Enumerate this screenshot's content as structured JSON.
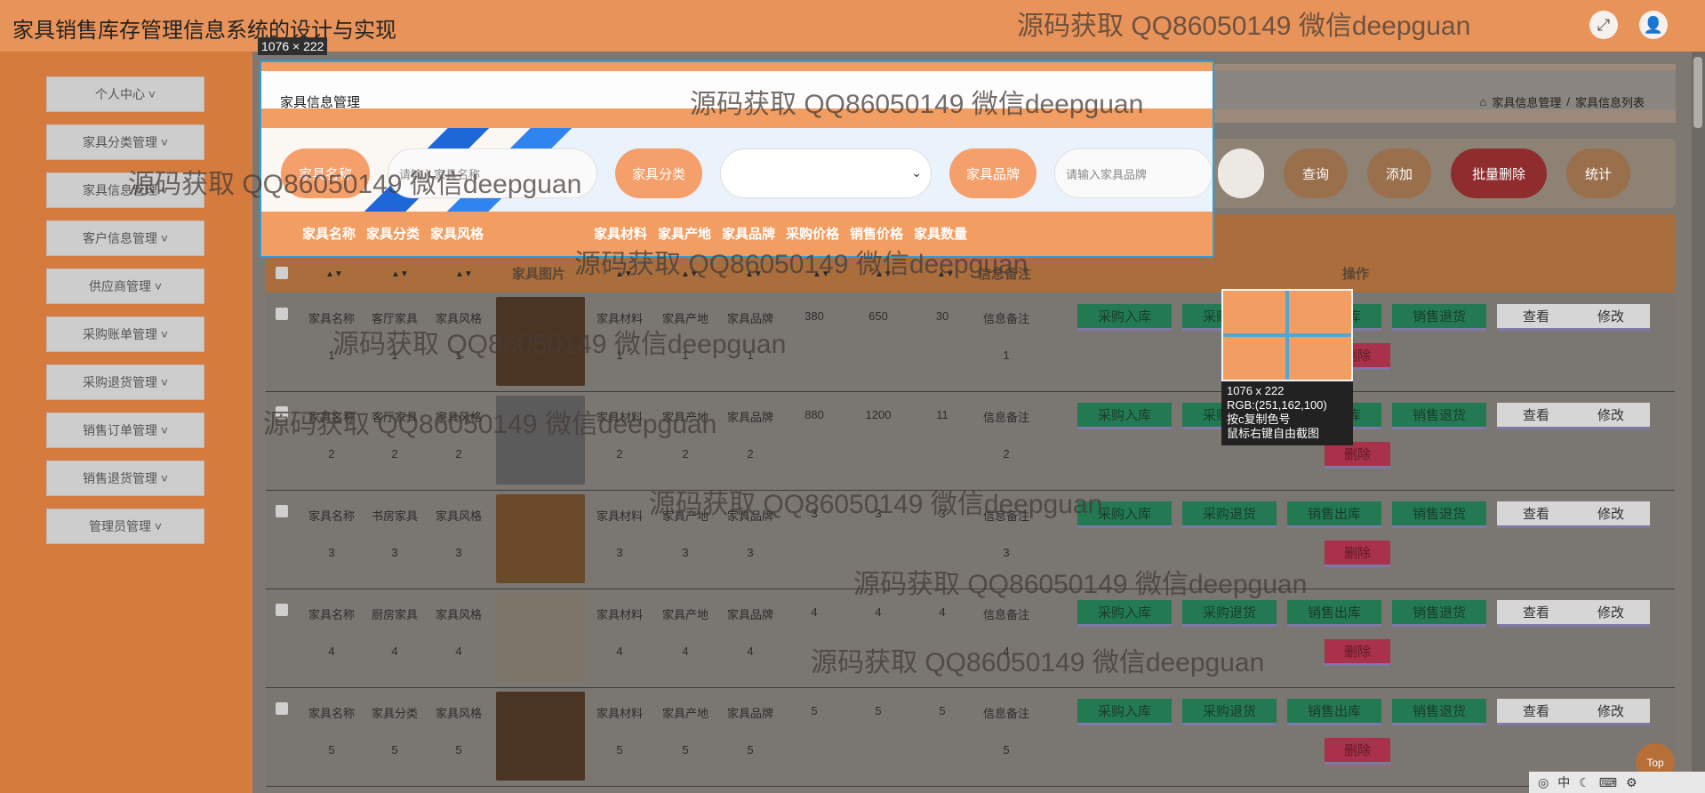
{
  "app": {
    "title": "家具销售库存管理信息系统的设计与实现"
  },
  "topbar": {
    "fullscreen_icon": "⤢",
    "user_icon": "👤"
  },
  "sidebar": {
    "items": [
      {
        "label": "个人中心 ˅"
      },
      {
        "label": "家具分类管理 ˅"
      },
      {
        "label": "家具信息管理 ˅"
      },
      {
        "label": "客户信息管理 ˅"
      },
      {
        "label": "供应商管理 ˅"
      },
      {
        "label": "采购账单管理 ˅"
      },
      {
        "label": "采购退货管理 ˅"
      },
      {
        "label": "销售订单管理 ˅"
      },
      {
        "label": "销售退货管理 ˅"
      },
      {
        "label": "管理员管理 ˅"
      }
    ]
  },
  "page": {
    "title": "家具信息管理",
    "breadcrumb": [
      "家具信息管理",
      "/",
      "家具信息列表"
    ],
    "home_icon": "⌂"
  },
  "search": {
    "name_label": "家具名称",
    "name_placeholder": "请输入家具名称",
    "category_label": "家具分类",
    "brand_label": "家具品牌",
    "brand_placeholder": "请输入家具品牌",
    "query": "查询",
    "add": "添加",
    "batch_delete": "批量删除",
    "stats": "统计"
  },
  "selection_columns": [
    "家具名称",
    "家具分类",
    "家具风格",
    "家具材料",
    "家具产地",
    "家具品牌",
    "采购价格",
    "销售价格",
    "家具数量"
  ],
  "table": {
    "headers": {
      "image": "家具图片",
      "remark": "信息备注",
      "ops": "操作"
    },
    "rows": [
      {
        "name": "家具名称",
        "name_n": "1",
        "cat": "客厅家具",
        "cat_n": "1",
        "style": "家具风格",
        "style_n": "1",
        "mat": "家具材料",
        "mat_n": "1",
        "origin": "家具产地",
        "origin_n": "1",
        "brand": "家具品牌",
        "brand_n": "1",
        "buy": "380",
        "sell": "650",
        "qty": "30",
        "remark": "信息备注",
        "remark_n": "1",
        "img": "#4a3525"
      },
      {
        "name": "家具名称",
        "name_n": "2",
        "cat": "客厅家具",
        "cat_n": "2",
        "style": "家具风格",
        "style_n": "2",
        "mat": "家具材料",
        "mat_n": "2",
        "origin": "家具产地",
        "origin_n": "2",
        "brand": "家具品牌",
        "brand_n": "2",
        "buy": "880",
        "sell": "1200",
        "qty": "11",
        "remark": "信息备注",
        "remark_n": "2",
        "img": "#5b5b5b"
      },
      {
        "name": "家具名称",
        "name_n": "3",
        "cat": "书房家具",
        "cat_n": "3",
        "style": "家具风格",
        "style_n": "3",
        "mat": "家具材料",
        "mat_n": "3",
        "origin": "家具产地",
        "origin_n": "3",
        "brand": "家具品牌",
        "brand_n": "3",
        "buy": "3",
        "sell": "3",
        "qty": "3",
        "remark": "信息备注",
        "remark_n": "3",
        "img": "#6b4a2c"
      },
      {
        "name": "家具名称",
        "name_n": "4",
        "cat": "厨房家具",
        "cat_n": "4",
        "style": "家具风格",
        "style_n": "4",
        "mat": "家具材料",
        "mat_n": "4",
        "origin": "家具产地",
        "origin_n": "4",
        "brand": "家具品牌",
        "brand_n": "4",
        "buy": "4",
        "sell": "4",
        "qty": "4",
        "remark": "信息备注",
        "remark_n": "4",
        "img": "#7d7468"
      },
      {
        "name": "家具名称",
        "name_n": "5",
        "cat": "家具分类",
        "cat_n": "5",
        "style": "家具风格",
        "style_n": "5",
        "mat": "家具材料",
        "mat_n": "5",
        "origin": "家具产地",
        "origin_n": "5",
        "brand": "家具品牌",
        "brand_n": "5",
        "buy": "5",
        "sell": "5",
        "qty": "5",
        "remark": "信息备注",
        "remark_n": "5",
        "img": "#4a3525"
      }
    ],
    "actions": {
      "purchase_in": "采购入库",
      "purchase_return": "采购退货",
      "sales_out": "销售出库",
      "sales_return": "销售退货",
      "view": "查看",
      "edit": "修改",
      "delete": "删除"
    }
  },
  "capture": {
    "size": "1076 × 222",
    "zoom_size": "1076 x 222",
    "rgb": "RGB:(251,162,100)",
    "copy_hint": "按c复制色号",
    "right_hint": "鼠标右键自由截图"
  },
  "watermark": "源码获取 QQ86050149 微信deepguan",
  "taskbar": {
    "lang": "中"
  },
  "top_button": "Top",
  "colors": {
    "accent": "#f29e62",
    "selection": "#2aa0d7",
    "green": "#237a52",
    "red": "#a9314a"
  }
}
